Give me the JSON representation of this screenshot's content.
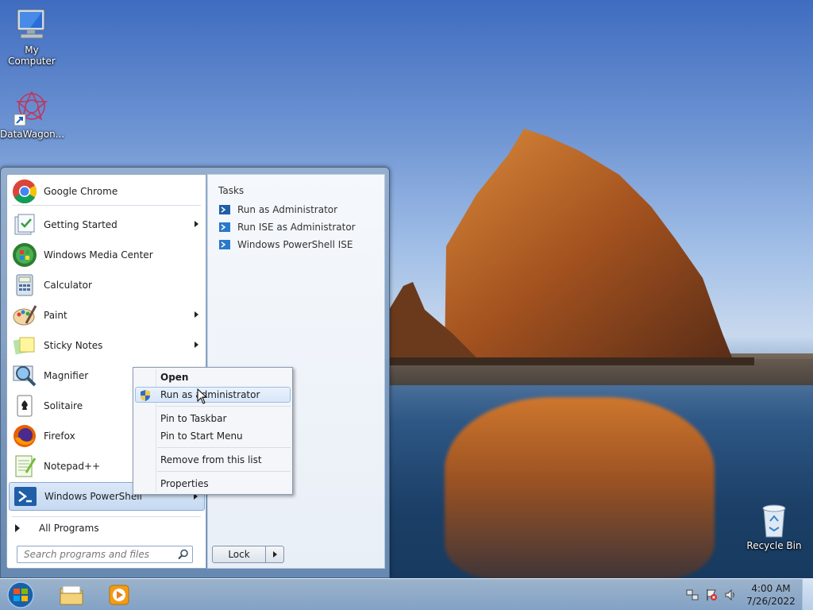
{
  "desktop": {
    "icons": [
      {
        "label": "My Computer"
      },
      {
        "label": "DataWagon..."
      },
      {
        "label": "Recycle Bin"
      }
    ]
  },
  "start_menu": {
    "programs": [
      {
        "label": "Google Chrome",
        "icon": "chrome-icon"
      },
      {
        "label": "Getting Started",
        "icon": "getting-started-icon",
        "has_submenu": true
      },
      {
        "label": "Windows Media Center",
        "icon": "media-center-icon"
      },
      {
        "label": "Calculator",
        "icon": "calculator-icon"
      },
      {
        "label": "Paint",
        "icon": "paint-icon",
        "has_submenu": true
      },
      {
        "label": "Sticky Notes",
        "icon": "sticky-notes-icon",
        "has_submenu": true
      },
      {
        "label": "Magnifier",
        "icon": "magnifier-icon"
      },
      {
        "label": "Solitaire",
        "icon": "solitaire-icon"
      },
      {
        "label": "Firefox",
        "icon": "firefox-icon"
      },
      {
        "label": "Notepad++",
        "icon": "notepadpp-icon"
      },
      {
        "label": "Windows PowerShell",
        "icon": "powershell-icon",
        "has_submenu": true,
        "selected": true
      }
    ],
    "all_programs": "All Programs",
    "search_placeholder": "Search programs and files",
    "lock_label": "Lock",
    "tasks": {
      "title": "Tasks",
      "items": [
        {
          "label": "Run as Administrator"
        },
        {
          "label": "Run ISE as Administrator"
        },
        {
          "label": "Windows PowerShell ISE"
        }
      ]
    }
  },
  "context_menu": {
    "items": [
      {
        "label": "Open",
        "bold": true
      },
      {
        "label": "Run as administrator",
        "hover": true,
        "icon": "uac-shield-icon"
      },
      {
        "label": "Pin to Taskbar"
      },
      {
        "label": "Pin to Start Menu"
      },
      {
        "label": "Remove from this list"
      },
      {
        "label": "Properties"
      }
    ]
  },
  "taskbar": {
    "pinned": [
      {
        "icon": "explorer-folder-icon"
      },
      {
        "icon": "media-player-icon"
      }
    ],
    "clock": {
      "time": "4:00 AM",
      "date": "7/26/2022"
    }
  },
  "colors": {
    "accent": "#3b6fb6",
    "selection": "#c5d9f1"
  }
}
